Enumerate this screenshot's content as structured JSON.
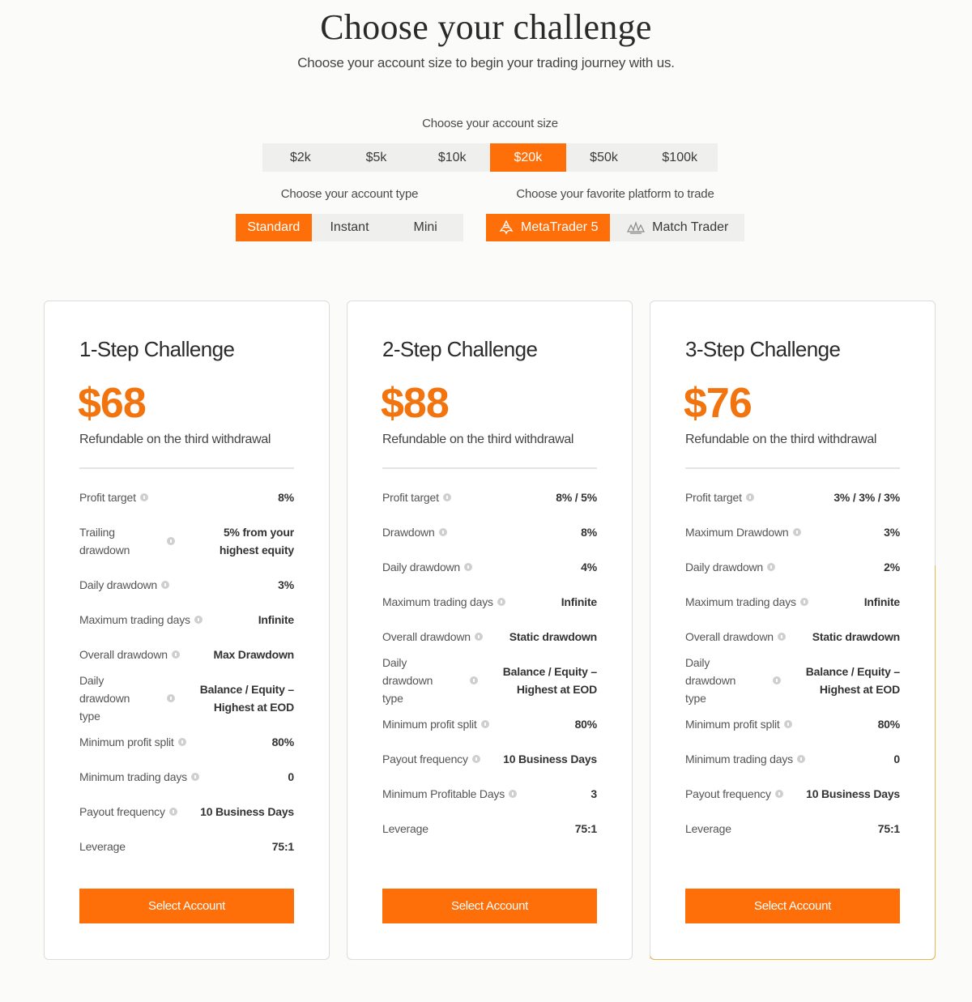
{
  "header": {
    "title": "Choose your challenge",
    "subtitle": "Choose your account size to begin your trading journey with us."
  },
  "account_size": {
    "label": "Choose your account size",
    "options": [
      "$2k",
      "$5k",
      "$10k",
      "$20k",
      "$50k",
      "$100k"
    ],
    "selected": "$20k"
  },
  "account_type": {
    "label": "Choose your account type",
    "options": [
      "Standard",
      "Instant",
      "Mini"
    ],
    "selected": "Standard"
  },
  "platform": {
    "label": "Choose your favorite platform to trade",
    "options": [
      {
        "label": "MetaTrader 5",
        "icon": "metatrader-icon"
      },
      {
        "label": "Match Trader",
        "icon": "match-trader-icon"
      }
    ],
    "selected": "MetaTrader 5"
  },
  "colors": {
    "accent": "#fe6f0a",
    "price": "#f2740e",
    "highlight_border": "#e8b64e"
  },
  "cards": [
    {
      "title": "1-Step Challenge",
      "price": "$68",
      "note": "Refundable on the third withdrawal",
      "rows": [
        {
          "label": "Profit target",
          "value": "8%"
        },
        {
          "label": "Trailing drawdown",
          "value": "5% from your highest equity"
        },
        {
          "label": "Daily drawdown",
          "value": "3%"
        },
        {
          "label": "Maximum trading days",
          "value": "Infinite"
        },
        {
          "label": "Overall drawdown",
          "value": "Max Drawdown"
        },
        {
          "label": "Daily drawdown type",
          "value": "Balance / Equity – Highest at EOD"
        },
        {
          "label": "Minimum profit split",
          "value": "80%"
        },
        {
          "label": "Minimum trading days",
          "value": "0"
        },
        {
          "label": "Payout frequency",
          "value": "10 Business Days"
        },
        {
          "label": "Leverage",
          "value": "75:1"
        }
      ],
      "button": "Select Account"
    },
    {
      "title": "2-Step Challenge",
      "price": "$88",
      "note": "Refundable on the third withdrawal",
      "rows": [
        {
          "label": "Profit target",
          "value": "8% / 5%"
        },
        {
          "label": "Drawdown",
          "value": "8%"
        },
        {
          "label": "Daily drawdown",
          "value": "4%"
        },
        {
          "label": "Maximum trading days",
          "value": "Infinite"
        },
        {
          "label": "Overall drawdown",
          "value": "Static drawdown"
        },
        {
          "label": "Daily drawdown type",
          "value": "Balance / Equity – Highest at EOD"
        },
        {
          "label": "Minimum profit split",
          "value": "80%"
        },
        {
          "label": "Payout frequency",
          "value": "10 Business Days"
        },
        {
          "label": "Minimum Profitable Days",
          "value": "3"
        },
        {
          "label": "Leverage",
          "value": "75:1"
        }
      ],
      "button": "Select Account"
    },
    {
      "title": "3-Step Challenge",
      "price": "$76",
      "note": "Refundable on the third withdrawal",
      "rows": [
        {
          "label": "Profit target",
          "value": "3% / 3% / 3%"
        },
        {
          "label": "Maximum Drawdown",
          "value": "3%"
        },
        {
          "label": "Daily drawdown",
          "value": "2%"
        },
        {
          "label": "Maximum trading days",
          "value": "Infinite"
        },
        {
          "label": "Overall drawdown",
          "value": "Static drawdown"
        },
        {
          "label": "Daily drawdown type",
          "value": "Balance / Equity – Highest at EOD"
        },
        {
          "label": "Minimum profit split",
          "value": "80%"
        },
        {
          "label": "Minimum trading days",
          "value": "0"
        },
        {
          "label": "Payout frequency",
          "value": "10 Business Days"
        },
        {
          "label": "Leverage",
          "value": "75:1"
        }
      ],
      "button": "Select Account"
    }
  ]
}
